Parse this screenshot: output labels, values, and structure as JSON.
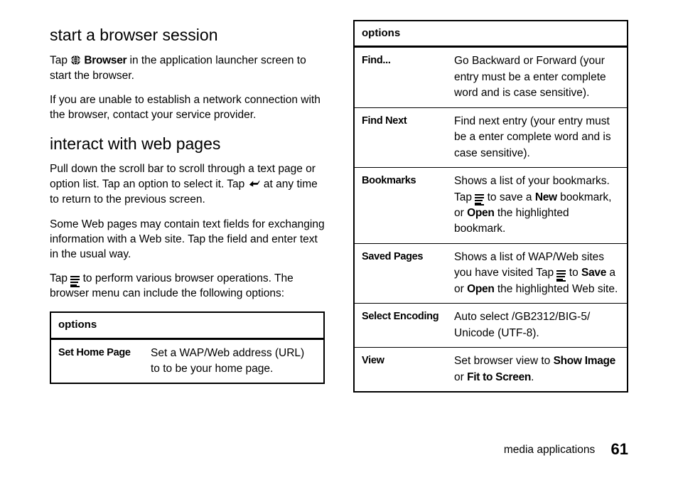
{
  "left": {
    "h1": "start a browser session",
    "p1a": "Tap ",
    "p1b": " Browser",
    "p1c": " in the application launcher screen to start the browser.",
    "p2": "If you are unable to establish a network connection with the browser, contact your service provider.",
    "h2": "interact with web pages",
    "p3a": "Pull down the scroll bar to scroll through a text page or option list. Tap an option to select it. Tap ",
    "p3b": " at any time to return to the previous screen.",
    "p4": "Some Web pages may contain text fields for exchanging information with a Web site. Tap the field and enter text in the usual way.",
    "p5a": "Tap ",
    "p5b": " to perform various browser operations. The browser menu can include the following options:",
    "table_header": "options",
    "row1_name": "Set Home Page",
    "row1_desc": "Set a WAP/Web address (URL) to to be your home page."
  },
  "right": {
    "table_header": "options",
    "rows": [
      {
        "name": "Find...",
        "desc": "Go Backward or Forward (your entry must be a enter complete word and is case sensitive)."
      },
      {
        "name": "Find Next",
        "desc": "Find next entry (your entry must be a enter complete word and is case sensitive)."
      },
      {
        "name": "Bookmarks",
        "pre": "Shows a list of your bookmarks. Tap ",
        "mid1": " to save a ",
        "b1": "New",
        "mid2": " bookmark, or ",
        "b2": "Open",
        "post": " the highlighted bookmark."
      },
      {
        "name": "Saved Pages",
        "pre": "Shows a list of WAP/Web sites you have visited Tap ",
        "mid1": " to ",
        "b1": "Save",
        "mid2": " a or ",
        "b2": "Open",
        "post": " the highlighted Web site."
      },
      {
        "name": "Select Encoding",
        "desc": "Auto select /GB2312/BIG-5/ Unicode (UTF-8)."
      },
      {
        "name": "View",
        "pre2": "Set browser view to ",
        "b1": "Show Image",
        "mid": " or ",
        "b2": "Fit to Screen",
        "post": "."
      }
    ]
  },
  "footer": {
    "section": "media applications",
    "page": "61"
  }
}
